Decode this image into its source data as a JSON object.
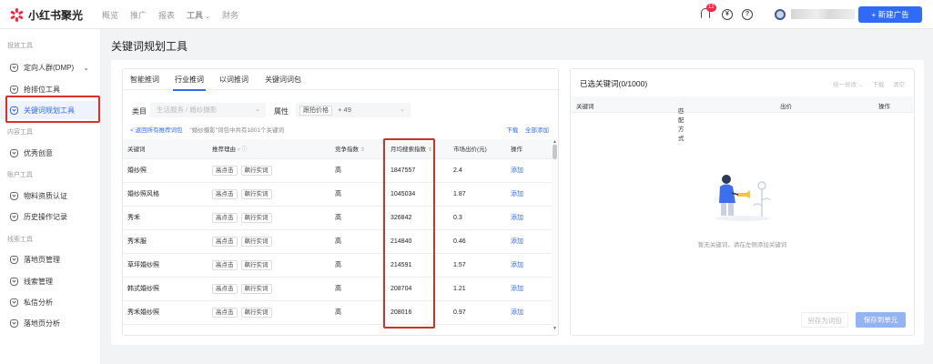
{
  "brand": {
    "name": "小红书聚光",
    "accent": "#ff2442",
    "primary": "#2f6bf6"
  },
  "topnav": [
    {
      "label": "概览",
      "active": false
    },
    {
      "label": "推广",
      "active": false
    },
    {
      "label": "报表",
      "active": false
    },
    {
      "label": "工具",
      "active": true
    },
    {
      "label": "财务",
      "active": false
    }
  ],
  "topbar": {
    "notification_count": "12",
    "new_button_label": "+ 新建广告",
    "icons": [
      "bell-icon",
      "coin-icon",
      "help-icon",
      "avatar"
    ]
  },
  "sidebar": {
    "sections": [
      {
        "title": "投放工具",
        "items": [
          "定向人群(DMP)",
          "抢排位工具",
          "关键词规划工具"
        ]
      },
      {
        "title": "内容工具",
        "items": [
          "优秀创意"
        ]
      },
      {
        "title": "账户工具",
        "items": [
          "物料资质认证",
          "历史操作记录"
        ]
      },
      {
        "title": "线索工具",
        "items": [
          "落地页管理",
          "线索管理",
          "私信分析",
          "落地页分析"
        ]
      }
    ],
    "active_item": "关键词规划工具"
  },
  "page_title": "关键词规划工具",
  "left_panel": {
    "tabs": [
      "智能推词",
      "行业推词",
      "以词推词",
      "关键词词包"
    ],
    "active_tab": "行业推词",
    "filter": {
      "category_label": "类目",
      "category_placeholder": "生活服务 / 婚纱摄影",
      "attribute_label": "属性",
      "attribute_chip": "跟拍价格",
      "attribute_more": "+ 49"
    },
    "hint": {
      "back_link": "< 返回所有推荐词包",
      "text": "\"婚纱摄影\"词包中共有1801个关键词"
    },
    "download_label": "下载",
    "add_all_label": "全部添加",
    "columns": [
      "关键词",
      "推荐理由",
      "竞争指数",
      "月均搜索指数",
      "市场出价(元)",
      "操作"
    ],
    "rows": [
      {
        "keyword": "婚纱照",
        "reasons": [
          "高点击",
          "飙行实词"
        ],
        "competition": "高",
        "monthly_search": "1847557",
        "bid": "2.4",
        "action": "添加"
      },
      {
        "keyword": "婚纱照风格",
        "reasons": [
          "高点击",
          "飙行实词"
        ],
        "competition": "高",
        "monthly_search": "1045034",
        "bid": "1.87",
        "action": "添加"
      },
      {
        "keyword": "秀禾",
        "reasons": [
          "高点击",
          "飙行实词"
        ],
        "competition": "高",
        "monthly_search": "326842",
        "bid": "0.3",
        "action": "添加"
      },
      {
        "keyword": "秀禾服",
        "reasons": [
          "高点击",
          "飙行实词"
        ],
        "competition": "高",
        "monthly_search": "214840",
        "bid": "0.46",
        "action": "添加"
      },
      {
        "keyword": "草坪婚纱照",
        "reasons": [
          "高点击",
          "飙行实词"
        ],
        "competition": "高",
        "monthly_search": "214591",
        "bid": "1.57",
        "action": "添加"
      },
      {
        "keyword": "韩式婚纱照",
        "reasons": [
          "高点击",
          "飙行实词"
        ],
        "competition": "高",
        "monthly_search": "208704",
        "bid": "1.21",
        "action": "添加"
      },
      {
        "keyword": "秀禾婚纱照",
        "reasons": [
          "高点击",
          "飙行实词"
        ],
        "competition": "高",
        "monthly_search": "208016",
        "bid": "0.97",
        "action": "添加"
      }
    ]
  },
  "right_panel": {
    "title": "已选关键词(0/1000)",
    "actions": [
      "统一修改 ⌄",
      "下载",
      "清空"
    ],
    "columns": [
      "关键词",
      "匹配方式",
      "出价",
      "操作"
    ],
    "empty_text": "暂无关键词，请在左侧添加关键词",
    "save_as_pack_label": "另存为词包",
    "save_to_unit_label": "保存到单元"
  }
}
